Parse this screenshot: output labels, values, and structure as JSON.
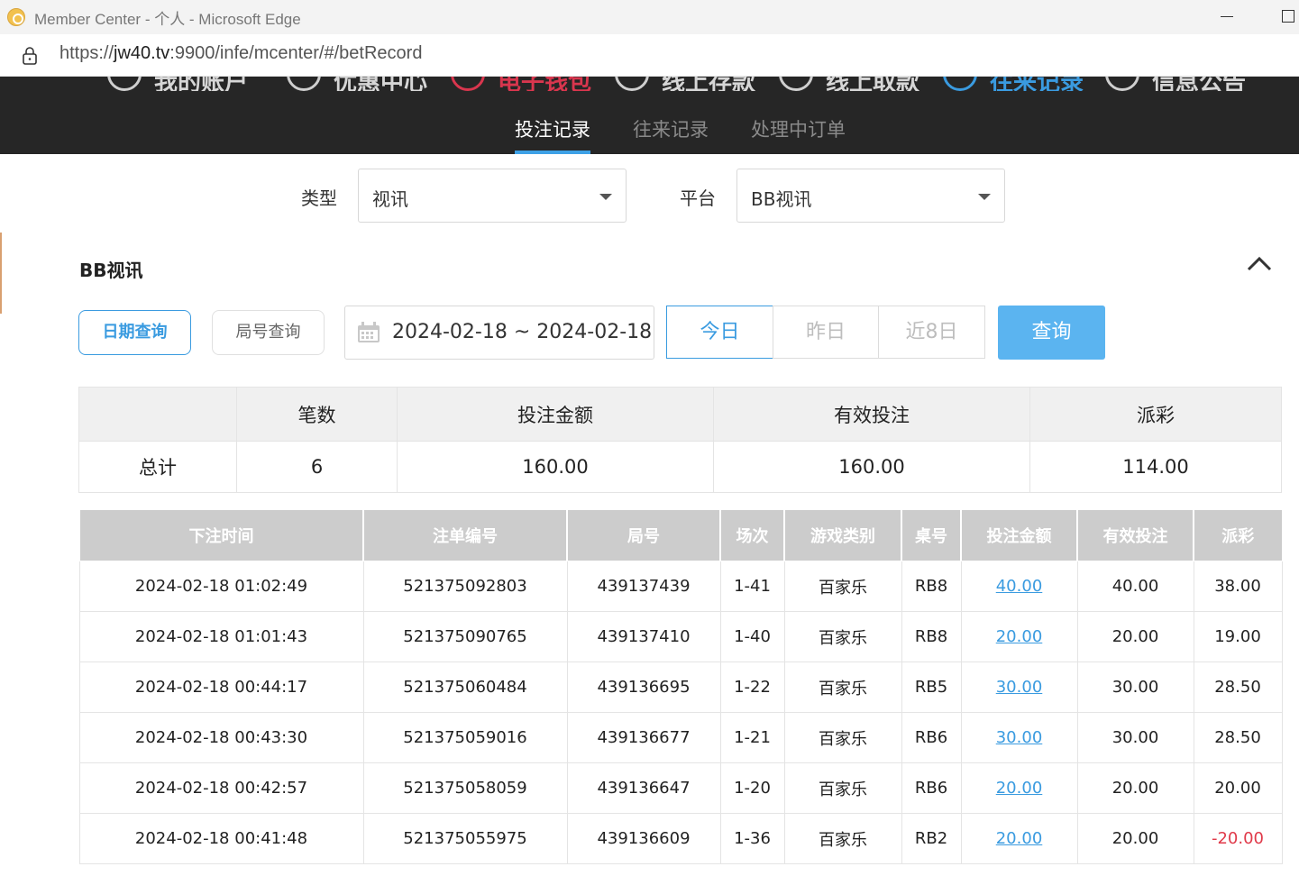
{
  "browser": {
    "title": "Member Center - 个人 - Microsoft Edge",
    "url_prefix": "https://",
    "url_host": "jw40.tv",
    "url_rest": ":9900/infe/mcenter/#/betRecord"
  },
  "topnav": {
    "items": [
      {
        "label": "我的账户 ˇ",
        "icon": "user-icon"
      },
      {
        "label": "优惠中心",
        "icon": "gift-icon"
      },
      {
        "label": "电子钱包",
        "icon": "wallet-icon",
        "color": "#d9364e"
      },
      {
        "label": "线上存款",
        "icon": "deposit-icon"
      },
      {
        "label": "线上取款",
        "icon": "withdraw-icon"
      },
      {
        "label": "往来记录",
        "icon": "records-icon",
        "color": "#3a9be0"
      },
      {
        "label": "信息公告",
        "icon": "bell-icon"
      }
    ],
    "subtabs": [
      {
        "label": "投注记录",
        "active": true
      },
      {
        "label": "往来记录",
        "active": false
      },
      {
        "label": "处理中订单",
        "active": false
      }
    ]
  },
  "filters": {
    "type_label": "类型",
    "type_value": "视讯",
    "platform_label": "平台",
    "platform_value": "BB视讯"
  },
  "section": {
    "title": "BB视讯",
    "date_query": "日期查询",
    "round_query": "局号查询",
    "date_range": "2024-02-18 ~ 2024-02-18",
    "today": "今日",
    "yesterday": "昨日",
    "last8": "近8日",
    "query": "查询"
  },
  "summary": {
    "headers": [
      "",
      "笔数",
      "投注金额",
      "有效投注",
      "派彩"
    ],
    "row": [
      "总计",
      "6",
      "160.00",
      "160.00",
      "114.00"
    ]
  },
  "records": {
    "headers": [
      "下注时间",
      "注单编号",
      "局号",
      "场次",
      "游戏类别",
      "桌号",
      "投注金额",
      "有效投注",
      "派彩"
    ],
    "rows": [
      [
        "2024-02-18 01:02:49",
        "521375092803",
        "439137439",
        "1-41",
        "百家乐",
        "RB8",
        "40.00",
        "40.00",
        "38.00"
      ],
      [
        "2024-02-18 01:01:43",
        "521375090765",
        "439137410",
        "1-40",
        "百家乐",
        "RB8",
        "20.00",
        "20.00",
        "19.00"
      ],
      [
        "2024-02-18 00:44:17",
        "521375060484",
        "439136695",
        "1-22",
        "百家乐",
        "RB5",
        "30.00",
        "30.00",
        "28.50"
      ],
      [
        "2024-02-18 00:43:30",
        "521375059016",
        "439136677",
        "1-21",
        "百家乐",
        "RB6",
        "30.00",
        "30.00",
        "28.50"
      ],
      [
        "2024-02-18 00:42:57",
        "521375058059",
        "439136647",
        "1-20",
        "百家乐",
        "RB6",
        "20.00",
        "20.00",
        "20.00"
      ],
      [
        "2024-02-18 00:41:48",
        "521375055975",
        "439136609",
        "1-36",
        "百家乐",
        "RB2",
        "20.00",
        "20.00",
        "-20.00"
      ]
    ]
  },
  "colors": {
    "accent": "#3a9be0",
    "negative": "#e03a4a",
    "nav_bg": "#262626"
  }
}
